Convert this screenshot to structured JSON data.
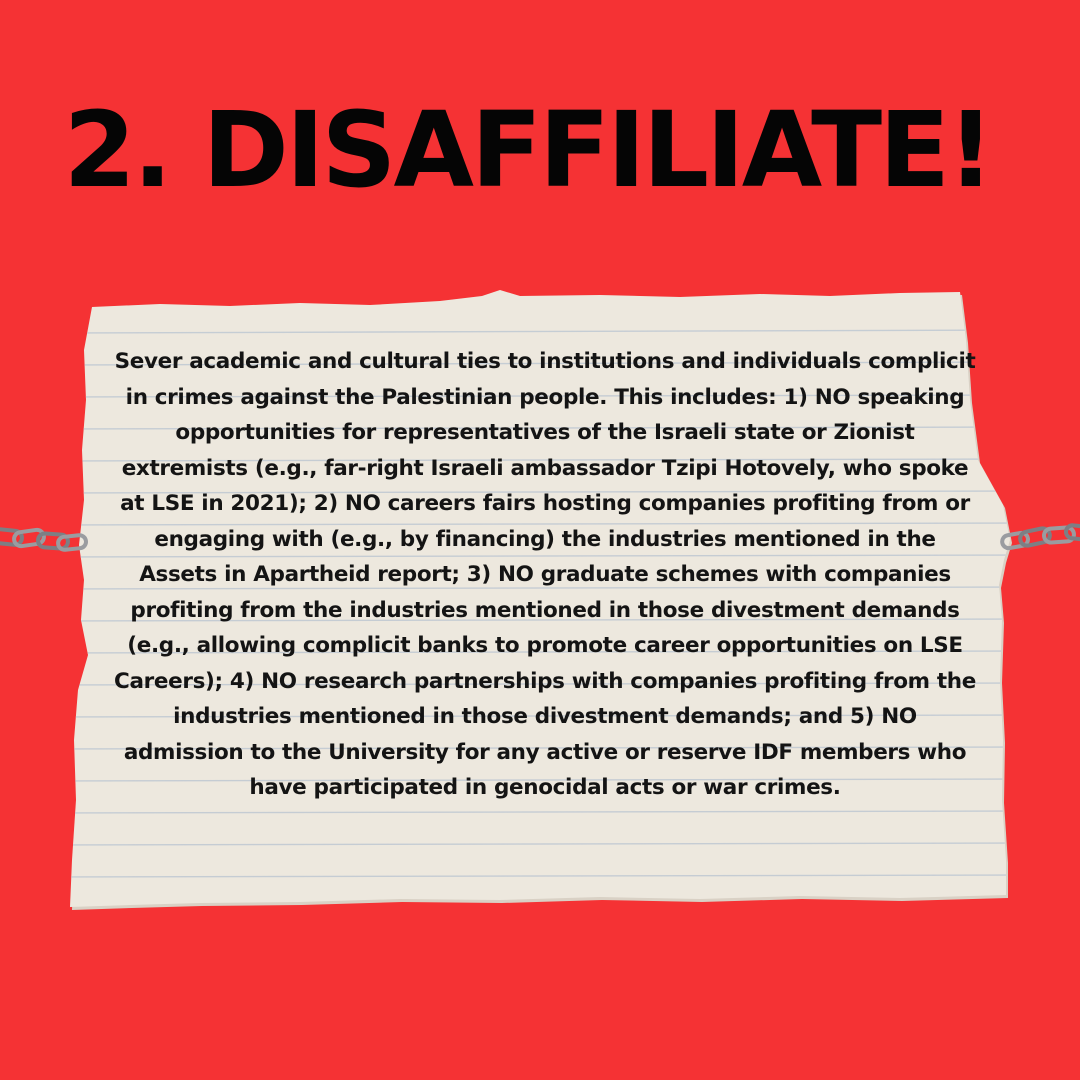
{
  "headline": "2. DISAFFILIATE!",
  "body_text": "Sever academic and cultural ties to institutions and individuals complicit in crimes against the Palestinian people. This includes: 1) NO speaking opportunities for representatives of the Israeli state or Zionist extremists (e.g., far-right Israeli ambassador Tzipi Hotovely, who spoke at LSE in 2021); 2) NO careers fairs hosting companies profiting from or engaging with (e.g., by financing) the industries mentioned in the Assets in Apartheid report; 3) NO graduate schemes with companies profiting from the industries mentioned in those divestment demands (e.g., allowing complicit banks to promote career opportunities on LSE Careers); 4) NO research partnerships with companies profiting from the industries mentioned in those divestment demands; and 5) NO admission to the University for any active or reserve IDF members who have participated in genocidal acts or war crimes.",
  "colors": {
    "background": "#f53234",
    "headline": "#050505",
    "paper": "#ece6dc",
    "paper_line": "#b9c3cf",
    "chain": "#7d7f84"
  },
  "icons": {
    "left_chain": "chain-icon",
    "right_chain": "chain-icon"
  }
}
